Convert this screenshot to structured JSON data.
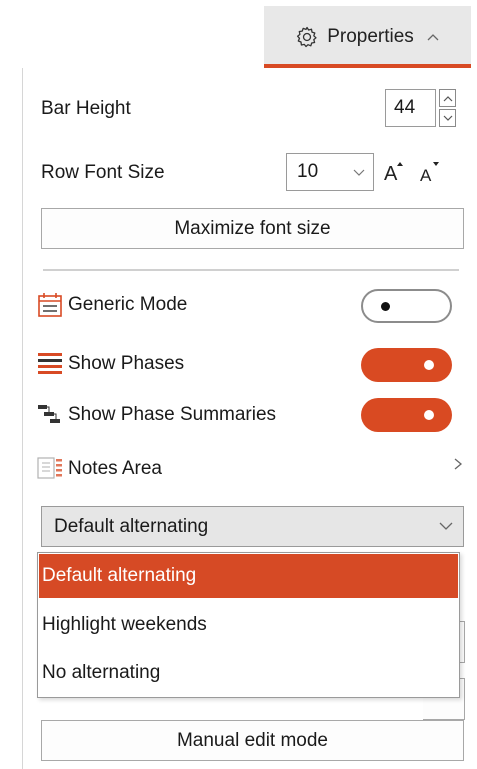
{
  "tab": {
    "label": "Properties",
    "icon": "gear-icon",
    "chevron": "^"
  },
  "bar_height": {
    "label": "Bar Height",
    "value": "44"
  },
  "row_font_size": {
    "label": "Row Font Size",
    "value": "10"
  },
  "maximize_button": "Maximize font size",
  "generic_mode": {
    "label": "Generic Mode",
    "enabled": false
  },
  "show_phases": {
    "label": "Show Phases",
    "enabled": true
  },
  "show_phase_summaries": {
    "label": "Show Phase Summaries",
    "enabled": true
  },
  "notes_area": {
    "label": "Notes Area"
  },
  "alternating": {
    "selected": "Default alternating",
    "options": [
      "Default alternating",
      "Highlight weekends",
      "No alternating"
    ]
  },
  "manual_edit_button": "Manual edit mode",
  "colors": {
    "accent": "#d94a22",
    "selected_item": "#d64a25"
  }
}
